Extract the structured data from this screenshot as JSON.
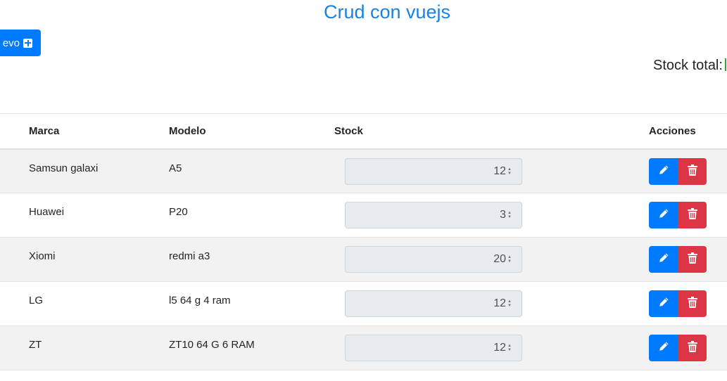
{
  "header": {
    "title": "Crud con vuejs",
    "new_button_label": "evo"
  },
  "summary": {
    "stock_total_label": "Stock total:"
  },
  "table": {
    "columns": [
      "Marca",
      "Modelo",
      "Stock",
      "Acciones"
    ],
    "rows": [
      {
        "marca": "Samsun galaxi",
        "modelo": "A5",
        "stock": "12"
      },
      {
        "marca": "Huawei",
        "modelo": "P20",
        "stock": "3"
      },
      {
        "marca": "Xiomi",
        "modelo": "redmi a3",
        "stock": "20"
      },
      {
        "marca": "LG",
        "modelo": "l5 64 g 4 ram",
        "stock": "12"
      },
      {
        "marca": "ZT",
        "modelo": "ZT10 64 G 6 RAM",
        "stock": "12"
      }
    ]
  },
  "colors": {
    "primary": "#007bff",
    "danger": "#dc3545",
    "title": "#1a82e2",
    "success": "#28a745"
  },
  "icons": {
    "new": "plus-square-icon",
    "edit": "pencil-icon",
    "delete": "trash-icon"
  }
}
